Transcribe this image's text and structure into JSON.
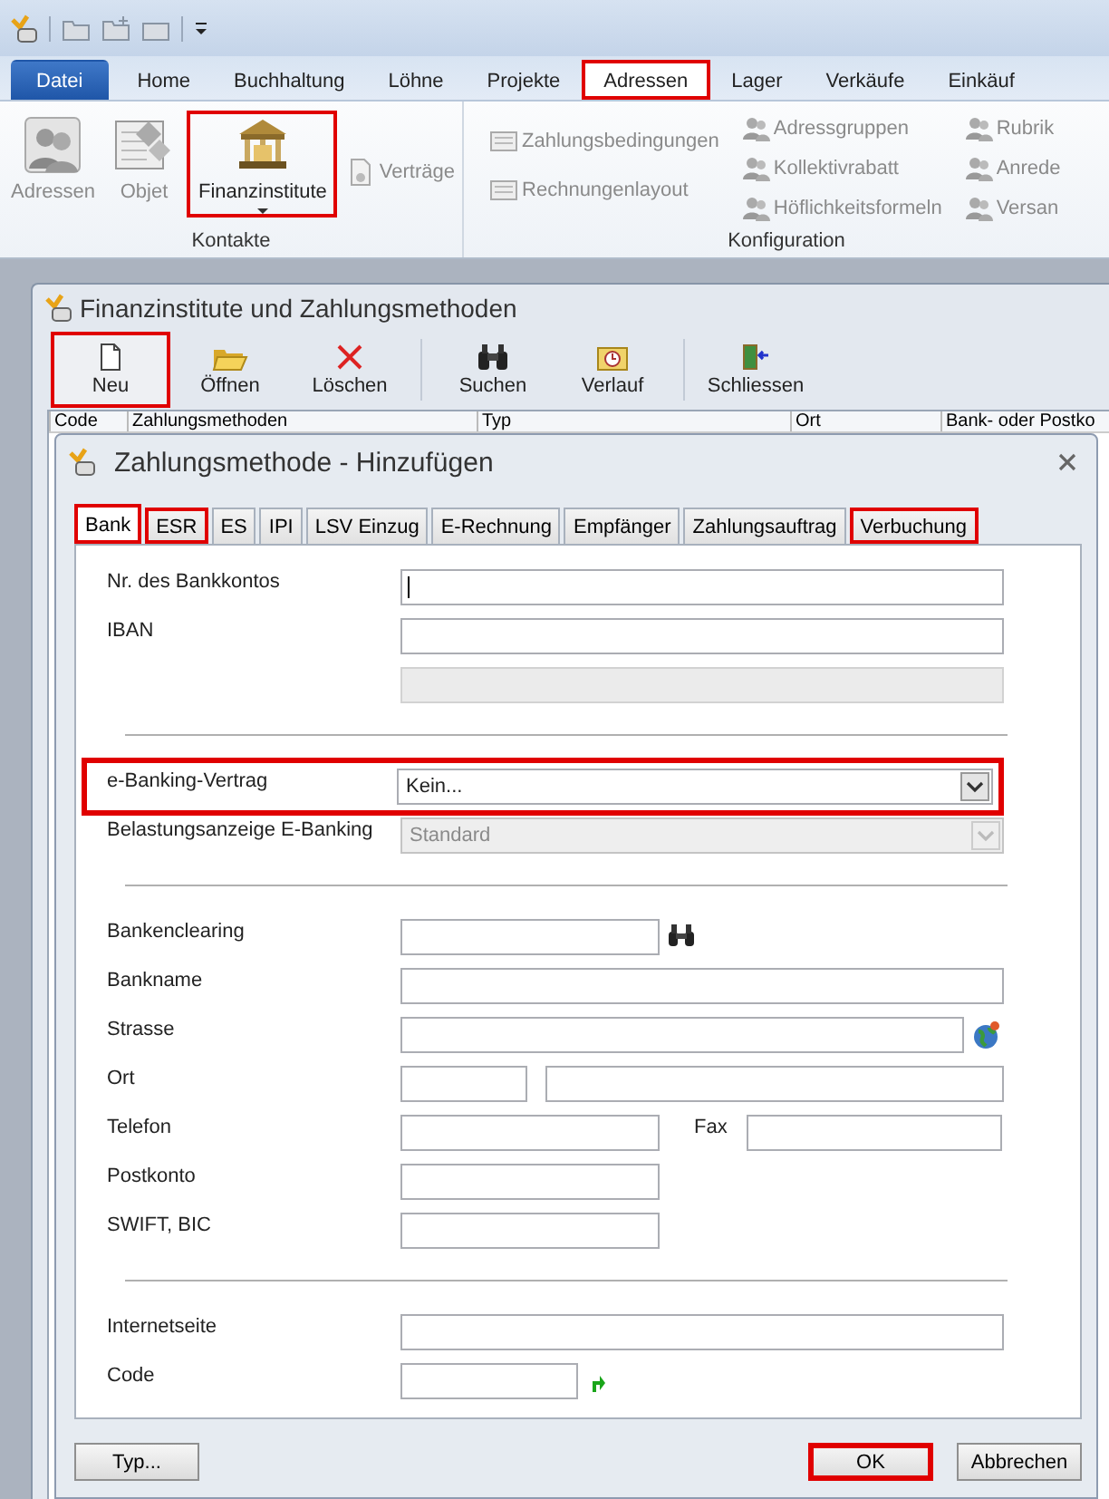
{
  "ribbon": {
    "tabs": [
      {
        "label": "Datei",
        "kind": "file",
        "selected": false,
        "highlighted": false
      },
      {
        "label": "Home",
        "kind": "tab",
        "selected": false,
        "highlighted": false
      },
      {
        "label": "Buchhaltung",
        "kind": "tab",
        "selected": false,
        "highlighted": false
      },
      {
        "label": "Löhne",
        "kind": "tab",
        "selected": false,
        "highlighted": false
      },
      {
        "label": "Projekte",
        "kind": "tab",
        "selected": false,
        "highlighted": false
      },
      {
        "label": "Adressen",
        "kind": "tab",
        "selected": true,
        "highlighted": true
      },
      {
        "label": "Lager",
        "kind": "tab",
        "selected": false,
        "highlighted": false
      },
      {
        "label": "Verkäufe",
        "kind": "tab",
        "selected": false,
        "highlighted": false
      },
      {
        "label": "Einkäuf",
        "kind": "tab",
        "selected": false,
        "highlighted": false
      }
    ],
    "groups": [
      {
        "label": "Kontakte",
        "columns": [
          [
            {
              "label": "Adressen",
              "kind": "people",
              "disabled": true,
              "highlighted": false
            }
          ],
          [
            {
              "label": "Objet",
              "kind": "objects",
              "disabled": true,
              "highlighted": false
            }
          ],
          [
            {
              "label": "Finanzinstitute",
              "kind": "dropdown",
              "disabled": false,
              "highlighted": true
            }
          ],
          [
            {
              "label": "Verträge",
              "kind": "small",
              "disabled": true,
              "highlighted": false
            }
          ]
        ]
      },
      {
        "label": "Konfiguration",
        "columns": [
          [
            {
              "label": "Zahlungsbedingungen",
              "kind": "small",
              "disabled": true,
              "highlighted": false
            },
            {
              "label": "Rechnungenlayout",
              "kind": "small",
              "disabled": true,
              "highlighted": false
            }
          ],
          [
            {
              "label": "Adressgruppen",
              "kind": "small",
              "disabled": true,
              "highlighted": false
            },
            {
              "label": "Kollektivrabatt",
              "kind": "small",
              "disabled": true,
              "highlighted": false
            },
            {
              "label": "Höflichkeitsformeln",
              "kind": "small",
              "disabled": true,
              "highlighted": false
            }
          ],
          [
            {
              "label": "Rubrik",
              "kind": "small",
              "disabled": true,
              "highlighted": false
            },
            {
              "label": "Anrede",
              "kind": "small",
              "disabled": true,
              "highlighted": false
            },
            {
              "label": "Versan",
              "kind": "small",
              "disabled": true,
              "highlighted": false
            }
          ]
        ]
      }
    ]
  },
  "window": {
    "title": "Finanzinstitute und Zahlungsmethoden",
    "toolbar": [
      {
        "label": "Neu",
        "kind": "new",
        "highlighted": true
      },
      {
        "label": "Öffnen",
        "kind": "open",
        "highlighted": false
      },
      {
        "label": "Löschen",
        "kind": "delete",
        "highlighted": false
      },
      {
        "label": "Suchen",
        "kind": "search",
        "highlighted": false
      },
      {
        "label": "Verlauf",
        "kind": "history",
        "highlighted": false
      },
      {
        "label": "Schliessen",
        "kind": "exit",
        "highlighted": false
      }
    ],
    "table": {
      "columns": [
        "Code",
        "Zahlungsmethoden",
        "Typ",
        "Ort",
        "Bank- oder Postko"
      ]
    }
  },
  "dialog": {
    "title": "Zahlungsmethode - Hinzufügen",
    "tabs": [
      {
        "label": "Bank",
        "selected": true,
        "highlighted": true
      },
      {
        "label": "ESR",
        "selected": false,
        "highlighted": true
      },
      {
        "label": "ES",
        "selected": false,
        "highlighted": false
      },
      {
        "label": "IPI",
        "selected": false,
        "highlighted": false
      },
      {
        "label": "LSV Einzug",
        "selected": false,
        "highlighted": false
      },
      {
        "label": "E-Rechnung",
        "selected": false,
        "highlighted": false
      },
      {
        "label": "Empfänger",
        "selected": false,
        "highlighted": false
      },
      {
        "label": "Zahlungsauftrag",
        "selected": false,
        "highlighted": false
      },
      {
        "label": "Verbuchung",
        "selected": false,
        "highlighted": true
      }
    ],
    "sections": [
      [
        {
          "label": "Nr. des Bankkontos",
          "kind": "full",
          "focused": true,
          "disabled": false
        },
        {
          "label": "IBAN",
          "kind": "full",
          "disabled": false
        },
        {
          "kind": "full",
          "disabled": true
        }
      ],
      [
        {
          "label": "e-Banking-Vertrag",
          "kind": "select",
          "value": "Kein...",
          "disabled": false,
          "highlighted": true
        },
        {
          "label": "Belastungsanzeige E-Banking",
          "kind": "select",
          "value": "Standard",
          "disabled": true,
          "highlighted": false
        }
      ],
      [
        {
          "label": "Bankenclearing",
          "kind": "lookup",
          "disabled": false
        },
        {
          "label": "Bankname",
          "kind": "full",
          "disabled": false
        },
        {
          "label": "Strasse",
          "kind": "address",
          "disabled": false
        },
        {
          "label": "Ort",
          "kind": "split",
          "disabled": false
        },
        {
          "label": "Telefon",
          "kind": "medium",
          "side_label": "Fax",
          "disabled": false
        },
        {
          "label": "Postkonto",
          "kind": "medium",
          "disabled": false
        },
        {
          "label": "SWIFT, BIC",
          "kind": "medium",
          "disabled": false
        }
      ],
      [
        {
          "label": "Internetseite",
          "kind": "full",
          "disabled": false
        },
        {
          "label": "Code",
          "kind": "code",
          "disabled": false
        }
      ]
    ],
    "buttons": {
      "left": [
        {
          "label": "Typ...",
          "highlighted": false
        }
      ],
      "right": [
        {
          "label": "OK",
          "highlighted": true
        },
        {
          "label": "Abbrechen",
          "highlighted": false
        }
      ]
    }
  }
}
